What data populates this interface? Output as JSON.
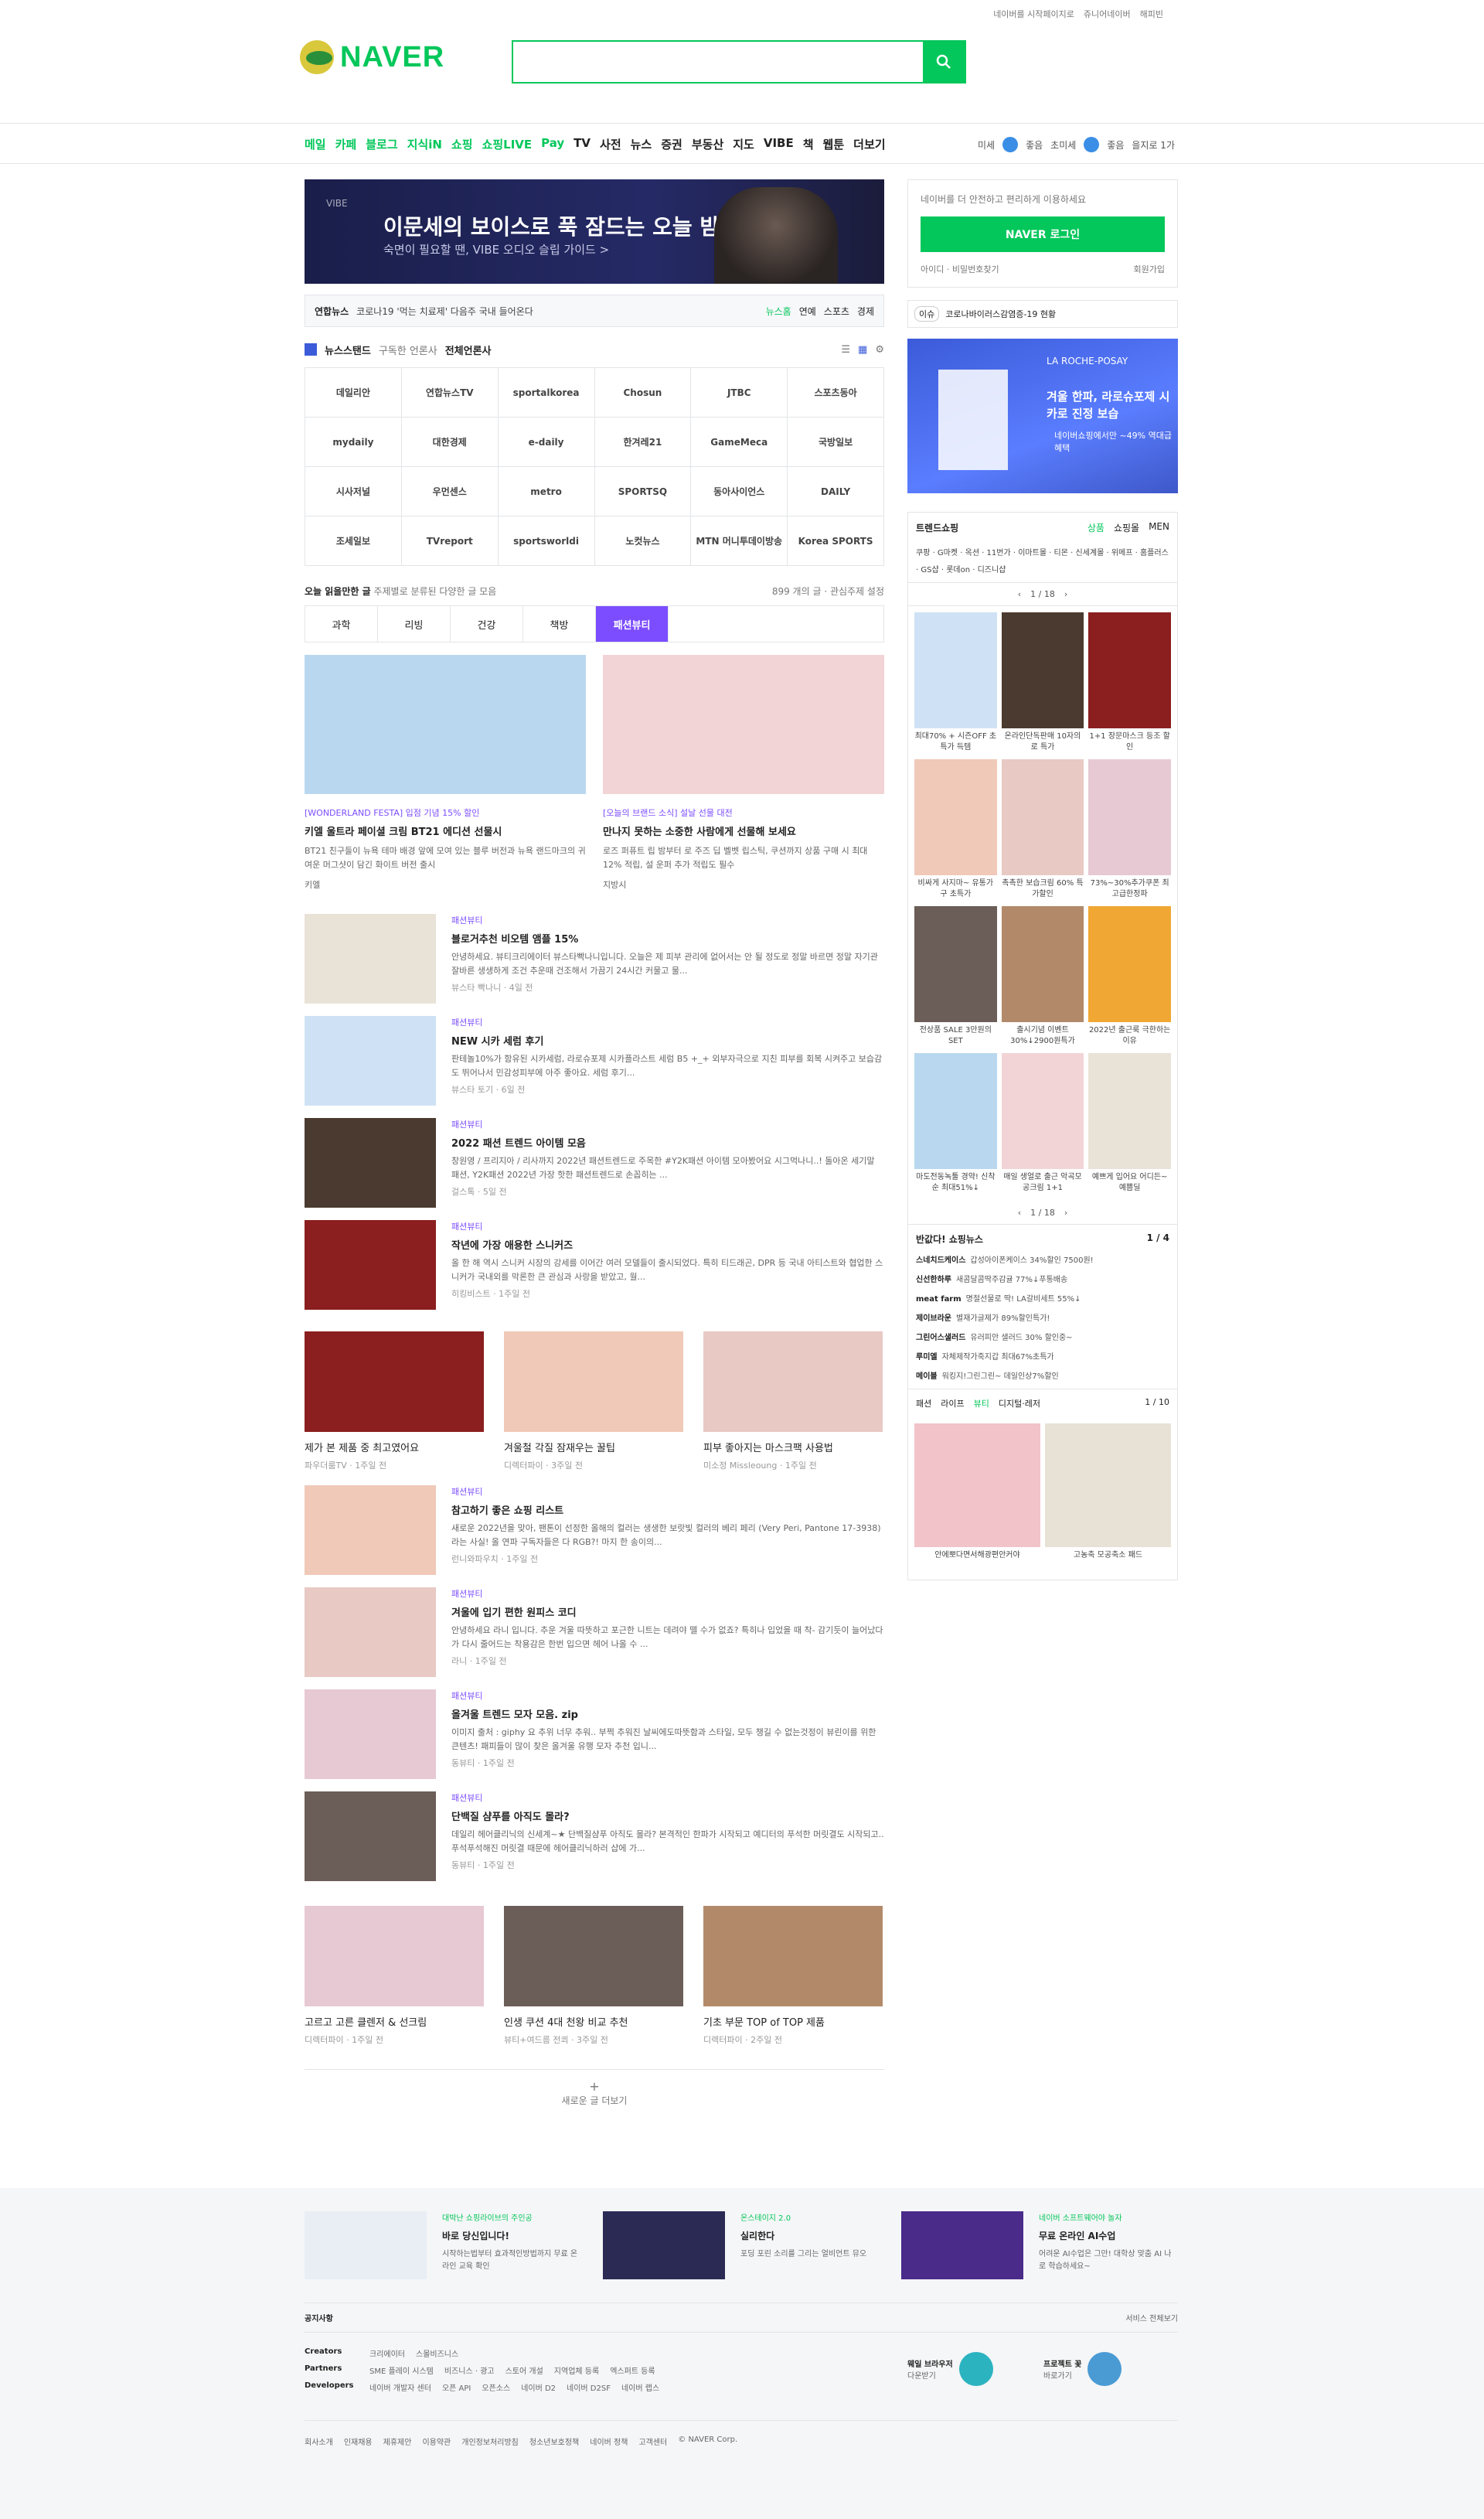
{
  "top_links": [
    "네이버를 시작페이지로",
    "쥬니어네이버",
    "해피빈"
  ],
  "logo": "NAVER",
  "search": {
    "placeholder": ""
  },
  "nav": [
    "메일",
    "카페",
    "블로그",
    "지식iN",
    "쇼핑",
    "쇼핑LIVE",
    "Pay",
    "TV",
    "사전",
    "뉴스",
    "증권",
    "부동산",
    "지도",
    "VIBE",
    "책",
    "웹툰",
    "더보기"
  ],
  "weather": {
    "dust1": "미세",
    "status1": "좋음",
    "dust2": "초미세",
    "status2": "좋음",
    "region": "을지로 1가"
  },
  "banner": {
    "brand": "VIBE",
    "title": "이문세의 보이스로 푹 잠드는 오늘 밤",
    "sub": "숙면이 필요할 땐, VIBE 오디오 슬립 가이드 >"
  },
  "newsbar": {
    "source": "연합뉴스",
    "headline": "코로나19 '먹는 치료제' 다음주 국내 들어온다",
    "links": [
      "뉴스홈",
      "연예",
      "스포츠",
      "경제"
    ]
  },
  "newsstand": {
    "title": "뉴스스탠드",
    "sub": "구독한 언론사",
    "all": "전체언론사",
    "papers": [
      "데일리안",
      "연합뉴스TV",
      "sportalkorea",
      "Chosun",
      "JTBC",
      "스포츠동아",
      "mydaily",
      "대한경제",
      "e-daily",
      "한겨레21",
      "GameMeca",
      "국방일보",
      "시사저널",
      "우먼센스",
      "metro",
      "SPORTSQ",
      "동아사이언스",
      "DAILY",
      "조세일보",
      "TVreport",
      "sportsworldi",
      "노컷뉴스",
      "MTN 머니투데이방송",
      "Korea SPORTS"
    ]
  },
  "recommend": {
    "title": "오늘 읽을만한 글",
    "sub": "주제별로 분류된 다양한 글 모음",
    "count": "899 개의 글",
    "setting": "관심주제 설정"
  },
  "tabs": [
    "과학",
    "리빙",
    "건강",
    "책방",
    "패션뷰티"
  ],
  "featured": [
    {
      "cat": "[WONDERLAND FESTA] 입점 기념 15% 할인",
      "title": "키엘 울트라 페이셜 크림 BT21 에디션 선물시",
      "desc": "BT21 친구들이 뉴욕 테마 배경 앞에 모여 있는 블루 버전과 뉴욕 랜드마크의 귀여운 머그샷이 담긴 화이트 버전 출시",
      "meta": "키엘"
    },
    {
      "cat": "[오늘의 브랜드 소식] 설날 선물 대전",
      "title": "만나지 못하는 소중한 사람에게 선물해 보세요",
      "desc": "로즈 퍼퓨트 립 밤부터 로 주즈 딥 벨벳 립스틱, 쿠션까지 상품 구매 시 최대 12% 적립, 설 운퍼 추가 적립도 필수",
      "meta": "지방시"
    }
  ],
  "list1": [
    {
      "cat": "패션뷰티",
      "title": "블로거추천 비오템 앰플 15%",
      "desc": "안녕하세요. 뷰티크리에이터 뷰스타빡나니입니다. 오늘은 제 피부 관리에 없어서는 안 될 정도로 정말 바르면 정말 자기관 잘바른 생생하게 조건 추운때 건조해서 가끔기 24시간 커물고 물...",
      "meta": "뷰스타 빡나니 · 4일 전"
    },
    {
      "cat": "패션뷰티",
      "title": "NEW 시카 세럼 후기",
      "desc": "판테놀10%가 함유된 시카세럼, 라로슈포제 시카플라스트 세럼 B5 +_+ 외부자극으로 지친 피부를 회복 시켜주고 보습감도 뛰어나서 민감성피부에 아주 좋아요. 세럼 후기...",
      "meta": "뷰스타 토기 · 6일 전"
    },
    {
      "cat": "패션뷰티",
      "title": "2022 패션 트렌드 아이템 모음",
      "desc": "창원영 / 프리지아 / 리사까지 2022년 패션트렌드로 주목한 #Y2K패션 아이템 모아봤어요 시그먹나니..! 돌아온 세기말 패션, Y2K패션 2022년 가장 핫한 패션트렌드로 손꼽히는 ...",
      "meta": "걸스톡 · 5일 전"
    },
    {
      "cat": "패션뷰티",
      "title": "작년에 가장 애용한 스니커즈",
      "desc": "올 한 해 역시 스니커 시장의 강세를 이어간 여러 모델들이 출시되었다. 특히 티드래곤, DPR 등 국내 아티스트와 협업한 스니커가 국내외를 막론한 큰 관심과 사랑을 받았고, 월...",
      "meta": "히킹비스트 · 1주일 전"
    }
  ],
  "trio1": [
    {
      "title": "제가 본 제품 중 최고였어요",
      "meta": "파우더룸TV · 1주일 전"
    },
    {
      "title": "겨울철 각질 잠재우는 꿀팁",
      "meta": "디렉터파이 · 3주일 전"
    },
    {
      "title": "피부 좋아지는 마스크팩 사용법",
      "meta": "미소정 Missleoung · 1주일 전"
    }
  ],
  "list2": [
    {
      "cat": "패션뷰티",
      "title": "참고하기 좋은 쇼핑 리스트",
      "desc": "새로운 2022년을 맞아, 팬톤이 선정한 올해의 컬러는 생생한 보랏빛 컬러의 베리 페리 (Very Peri, Pantone 17-3938) 라는 사실! 올 연파 구독자들은 다 RGB?! 마지 한 송이의...",
      "meta": "런니와파우치 · 1주일 전"
    },
    {
      "cat": "패션뷰티",
      "title": "겨울에 입기 편한 원피스 코디",
      "desc": "안녕하세요 라니 입니다. 추운 겨울 따뜻하고 포근한 니트는 데려야 뗄 수가 없죠? 특히나 입었을 때 착- 감기듯이 늘어났다가 다시 줄어드는 착용감은 한번 입으면 헤어 나올 수 ...",
      "meta": "라니 · 1주일 전"
    },
    {
      "cat": "패션뷰티",
      "title": "올겨울 트렌드 모자 모음. zip",
      "desc": "이미지 출처 : giphy 요 추위 너무 추워.. 부쩍 추워진 날씨에도따뜻함과 스타일, 모두 챙길 수 없는것정이 뷰린이를 위한 큰텐츠! 패피들이 많이 찾은 올겨울 유행 모자 추천 입니...",
      "meta": "동뷰티 · 1주일 전"
    },
    {
      "cat": "패션뷰티",
      "title": "단백질 샴푸를 아직도 몰라?",
      "desc": "데일리 헤어클리닉의 신세계~★ 단백질샴푸 아직도 몰라? 본격적인 한파가 시작되고 예디터의 푸석한 머릿결도 시작되고.. 푸석푸석해진 머릿결 때문에 헤어클리닉하러 샵에 가...",
      "meta": "동뷰티 · 1주일 전"
    }
  ],
  "trio2": [
    {
      "title": "고르고 고른 클렌저 & 선크림",
      "meta": "디렉터파이 · 1주일 전"
    },
    {
      "title": "인생 쿠션 4대 천왕 비교 추천",
      "meta": "뷰티+여드름 전쾨 · 3주일 전"
    },
    {
      "title": "기초 부문 TOP of TOP 제품",
      "meta": "디렉터파이 · 2주일 전"
    }
  ],
  "more": "새로운 글 더보기",
  "login": {
    "hint": "네이버를 더 안전하고 편리하게 이용하세요",
    "button": "NAVER 로그인",
    "find": "아이디 · 비밀번호찾기",
    "join": "회원가입"
  },
  "issue": {
    "tag": "이슈",
    "text": "코로나바이러스감염증-19 현황"
  },
  "ad": {
    "brand": "LA ROCHE-POSAY",
    "title": "겨울 한파, 라로슈포제 시카로 진정 보습",
    "sub": "네이버쇼핑에서만 ~49% 역대급 혜택"
  },
  "shopping": {
    "title": "트렌드쇼핑",
    "tabs": [
      "상품",
      "쇼핑몰",
      "MEN"
    ],
    "malls": "쿠팡 · G마켓 · 옥션 · 11번가 · 이마트몰 · 티몬 · 신세계몰 · 위메프 · 홈플러스 · GS샵 · 롯데on · 디즈니샵",
    "page": "1 / 18",
    "products": [
      "최대70% + 시즌OFF 초특가 득템",
      "온라인단독판매 10자의로 특가",
      "1+1 장문마스크 등조 할인",
      "비싸게 사지마~ 유통가구 초특가",
      "촉촉한 보습크림 60% 특가할인",
      "73%~30%추가쿠폰 최고급한정파",
      "전상품 SALE 3만원의 SET",
      "출시기념 이벤트 30%↓2900원특가",
      "2022년 출근룩 극한하는 이유",
      "마도전동녹툴 경약! 신착순 최대51%↓",
      "매일 생얼로 출근 악곡모공크림 1+1",
      "예쁘게 입어요 어디든~예쁨딜"
    ],
    "news_title": "반값다! 쇼핑뉴스",
    "news_page": "1 / 4",
    "news": [
      [
        "스네치드케이스",
        "갑성아이폰케이스 34%할인 7500원!"
      ],
      [
        "신선한하루",
        "새콤달콤딱주감귤 77%↓푸통배송"
      ],
      [
        "meat farm",
        "명절선물로 딱! LA갈비세트 55%↓"
      ],
      [
        "제이브라운",
        "별재가글제가 89%할인특가!"
      ],
      [
        "그린어스샐러드",
        "유러피안 샐러드 30% 할인중~"
      ],
      [
        "루미엘",
        "자체제작가죽지갑 최대67%초특가"
      ],
      [
        "메이블",
        "워킹지!그린그린~ 데일인상7%할인"
      ]
    ],
    "cat_tabs": [
      "패션",
      "라이프",
      "뷰티",
      "디지털·레저"
    ],
    "cat_page": "1 / 10",
    "cat_products": [
      "안에뽀다면서해광편안커야",
      "고농축 모공축소 패드"
    ]
  },
  "footer": {
    "promos": [
      {
        "l1": "대박난 쇼핑라이브의 주인공",
        "l2": "바로 당신입니다!",
        "l3": "시작하는법부터 효과적인방법까지 무료 온라인 교육 확인"
      },
      {
        "l1": "온스테이지 2.0",
        "l2": "실리한다",
        "l3": "포딩 포린 소리를 그리는 얼비언트 뮤오"
      },
      {
        "l1": "네이버 소프트웨어야 놀자",
        "l2": "무료 온라인 AI수업",
        "l3": "어려운 AI수업은 그만! 대학상 맞춤 AI 나로 학습하세요~"
      }
    ],
    "notice": "공지사항",
    "services": "서비스 전체보기",
    "creators": [
      "크리에이터",
      "스몰비즈니스"
    ],
    "partners": [
      "SME 플레이 시스템",
      "비즈니스 · 광고",
      "스토어 개설",
      "지역업체 등록",
      "엑스퍼트 등록"
    ],
    "developers": [
      "네이버 개발자 센터",
      "오픈 API",
      "오픈소스",
      "네이버 D2",
      "네이버 D2SF",
      "네이버 랩스"
    ],
    "whale": "웨일 브라우저",
    "whale_sub": "다운받기",
    "project": "프로젝트 꽃",
    "project_sub": "바로가기",
    "bottom": [
      "회사소개",
      "인재채용",
      "제휴제안",
      "이용약관",
      "개인정보처리방침",
      "청소년보호정책",
      "네이버 정책",
      "고객센터",
      "© NAVER Corp."
    ]
  }
}
